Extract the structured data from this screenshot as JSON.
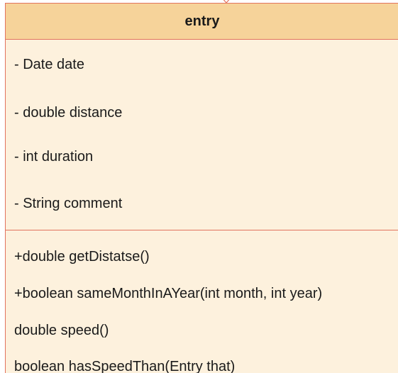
{
  "colors": {
    "header_fill": "#f6d39a",
    "body_fill": "#fdf1dd",
    "border": "#e2735e",
    "text": "#1a1a1a"
  },
  "class": {
    "name": "entry",
    "attributes": [
      "- Date date",
      "- double distance",
      "- int duration",
      "- String comment"
    ],
    "operations": [
      "+double getDistatse()",
      "+boolean sameMonthInAYear(int month, int year)",
      "double speed()",
      "boolean hasSpeedThan(Entry that)"
    ]
  }
}
